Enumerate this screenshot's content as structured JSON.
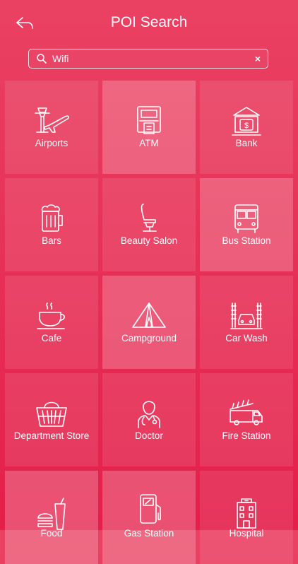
{
  "header": {
    "title": "POI Search"
  },
  "search": {
    "value": "Wifi",
    "clear_symbol": "×"
  },
  "categories": [
    {
      "label": "Airports",
      "icon": "airport-icon"
    },
    {
      "label": "ATM",
      "icon": "atm-icon"
    },
    {
      "label": "Bank",
      "icon": "bank-icon"
    },
    {
      "label": "Bars",
      "icon": "beer-mug-icon"
    },
    {
      "label": "Beauty Salon",
      "icon": "salon-chair-icon"
    },
    {
      "label": "Bus Station",
      "icon": "bus-icon"
    },
    {
      "label": "Cafe",
      "icon": "coffee-cup-icon"
    },
    {
      "label": "Campground",
      "icon": "tent-icon"
    },
    {
      "label": "Car Wash",
      "icon": "car-wash-icon"
    },
    {
      "label": "Department Store",
      "icon": "shopping-basket-icon"
    },
    {
      "label": "Doctor",
      "icon": "doctor-icon"
    },
    {
      "label": "Fire Station",
      "icon": "fire-truck-icon"
    },
    {
      "label": "Food",
      "icon": "fast-food-icon"
    },
    {
      "label": "Gas Station",
      "icon": "gas-pump-icon"
    },
    {
      "label": "Hospital",
      "icon": "hospital-icon"
    }
  ]
}
